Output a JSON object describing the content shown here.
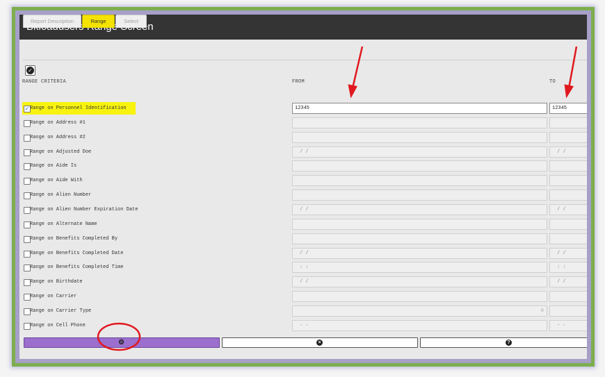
{
  "window": {
    "title": "Bkloadusers Range Screen"
  },
  "tabs": [
    {
      "label": "Report Description",
      "active": false
    },
    {
      "label": "Range",
      "active": true
    },
    {
      "label": "Select",
      "active": false
    }
  ],
  "headers": {
    "criteria": "RANGE CRITERIA",
    "from": "FROM",
    "to": "TO"
  },
  "rows": [
    {
      "label": "Range on Personnel Identification",
      "checked": true,
      "from": "12345",
      "to": "12345"
    },
    {
      "label": "Range on Address #1",
      "checked": false,
      "from": "",
      "to": ""
    },
    {
      "label": "Range on Address #2",
      "checked": false,
      "from": "",
      "to": ""
    },
    {
      "label": "Range on Adjusted Doe",
      "checked": false,
      "from": " /  /",
      "to": " /  /"
    },
    {
      "label": "Range on Aide Is",
      "checked": false,
      "from": "",
      "to": ""
    },
    {
      "label": "Range on Aide With",
      "checked": false,
      "from": "",
      "to": ""
    },
    {
      "label": "Range on Alien Number",
      "checked": false,
      "from": "",
      "to": ""
    },
    {
      "label": "Range on Alien Number Expiration Date",
      "checked": false,
      "from": " /  /",
      "to": " /  /"
    },
    {
      "label": "Range on Alternate Name",
      "checked": false,
      "from": "",
      "to": ""
    },
    {
      "label": "Range on Benefits Completed By",
      "checked": false,
      "from": "",
      "to": ""
    },
    {
      "label": "Range on Benefits Completed Date",
      "checked": false,
      "from": " /  /",
      "to": " /  /"
    },
    {
      "label": "Range on Benefits Completed Time",
      "checked": false,
      "from": " :  :",
      "to": " :  :"
    },
    {
      "label": "Range on Birthdate",
      "checked": false,
      "from": " /  /",
      "to": " /  /"
    },
    {
      "label": "Range on Carrier",
      "checked": false,
      "from": "",
      "to": ""
    },
    {
      "label": "Range on Carrier Type",
      "checked": false,
      "from": "",
      "from_right": "0",
      "to": ""
    },
    {
      "label": "Range on Cell Phone",
      "checked": false,
      "from": " -  -",
      "to": " -  -"
    }
  ],
  "icons": {
    "check_all": "check-circle-icon",
    "run": "gear-icon",
    "cancel": "close-circle-icon",
    "help": "help-circle-icon"
  },
  "colors": {
    "accent_tab": "#f4e300",
    "run_button": "#9c6fcf",
    "annotation": "#e0191f",
    "frame": "#7dae4e"
  }
}
